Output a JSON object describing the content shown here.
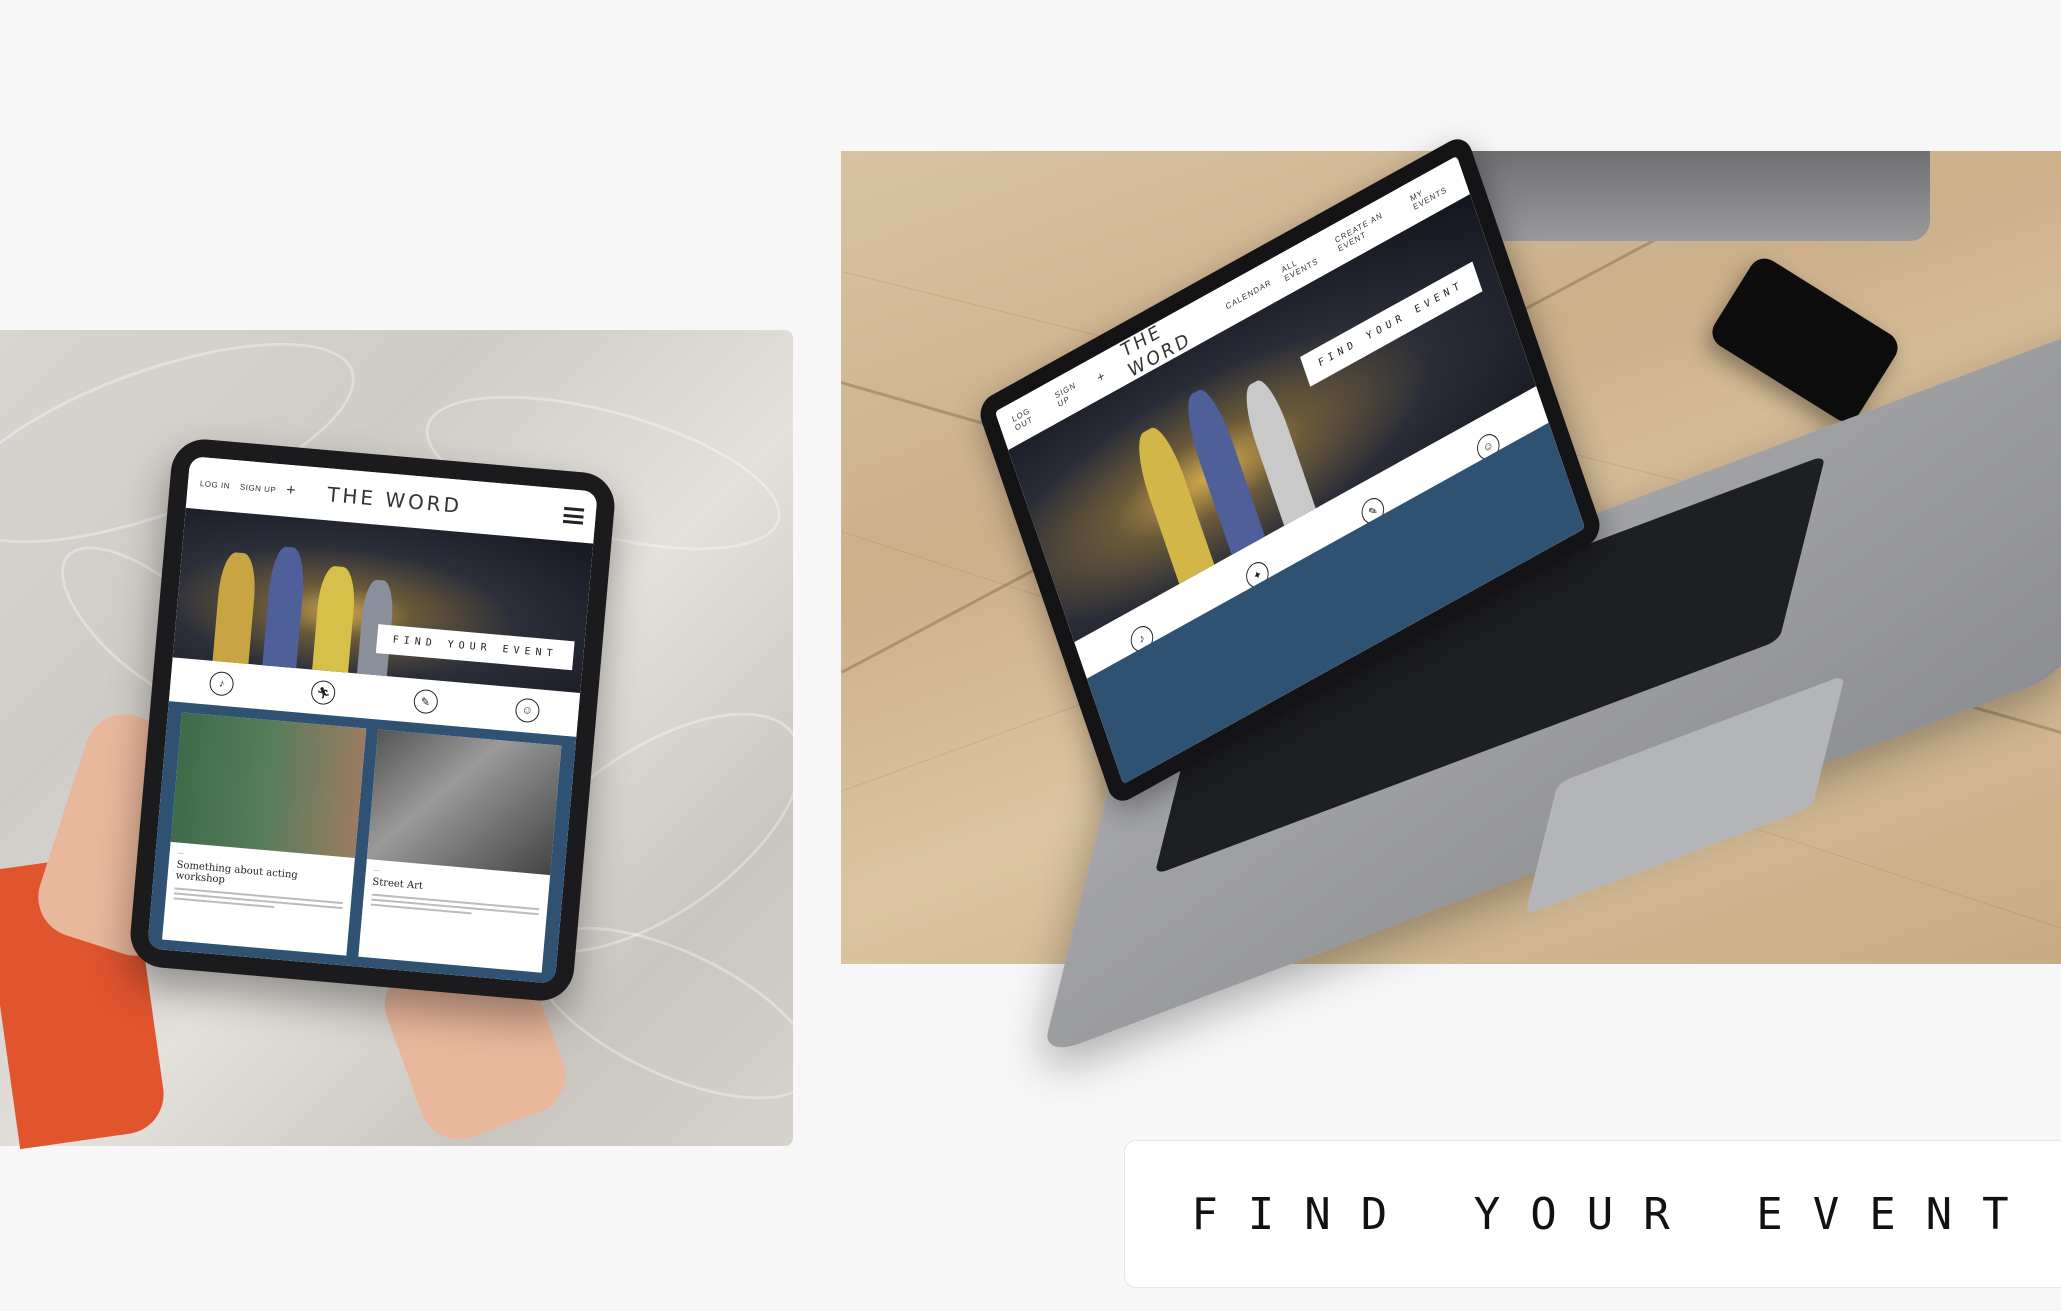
{
  "site": {
    "logo": "THE WORD",
    "tagline": "FIND YOUR EVENT"
  },
  "tablet": {
    "nav": {
      "login": "LOG IN",
      "signup": "SIGN UP",
      "plus": "+",
      "menu_icon": "hamburger-icon"
    },
    "hero_tag": "FIND YOUR EVENT",
    "icons": [
      "music-note-icon",
      "running-figure-icon",
      "brush-icon",
      "mask-icon"
    ],
    "cards": [
      {
        "title": "Something about acting workshop",
        "image": "two-women-portrait"
      },
      {
        "title": "Street Art",
        "image": "graffiti-wall"
      }
    ]
  },
  "laptop": {
    "nav": {
      "logout": "LOG OUT",
      "signup": "SIGN UP",
      "plus": "+",
      "calendar": "CALENDAR",
      "all_events": "ALL EVENTS",
      "create_event": "CREATE AN EVENT",
      "my_events": "MY EVENTS"
    },
    "hero_tag": "FIND YOUR EVENT"
  },
  "bottom_card": {
    "text": "FIND YOUR EVENT"
  },
  "colors": {
    "page_bg": "#f7f7f7",
    "brand_blue": "#2f5273",
    "sleeve_orange": "#e0542e"
  }
}
